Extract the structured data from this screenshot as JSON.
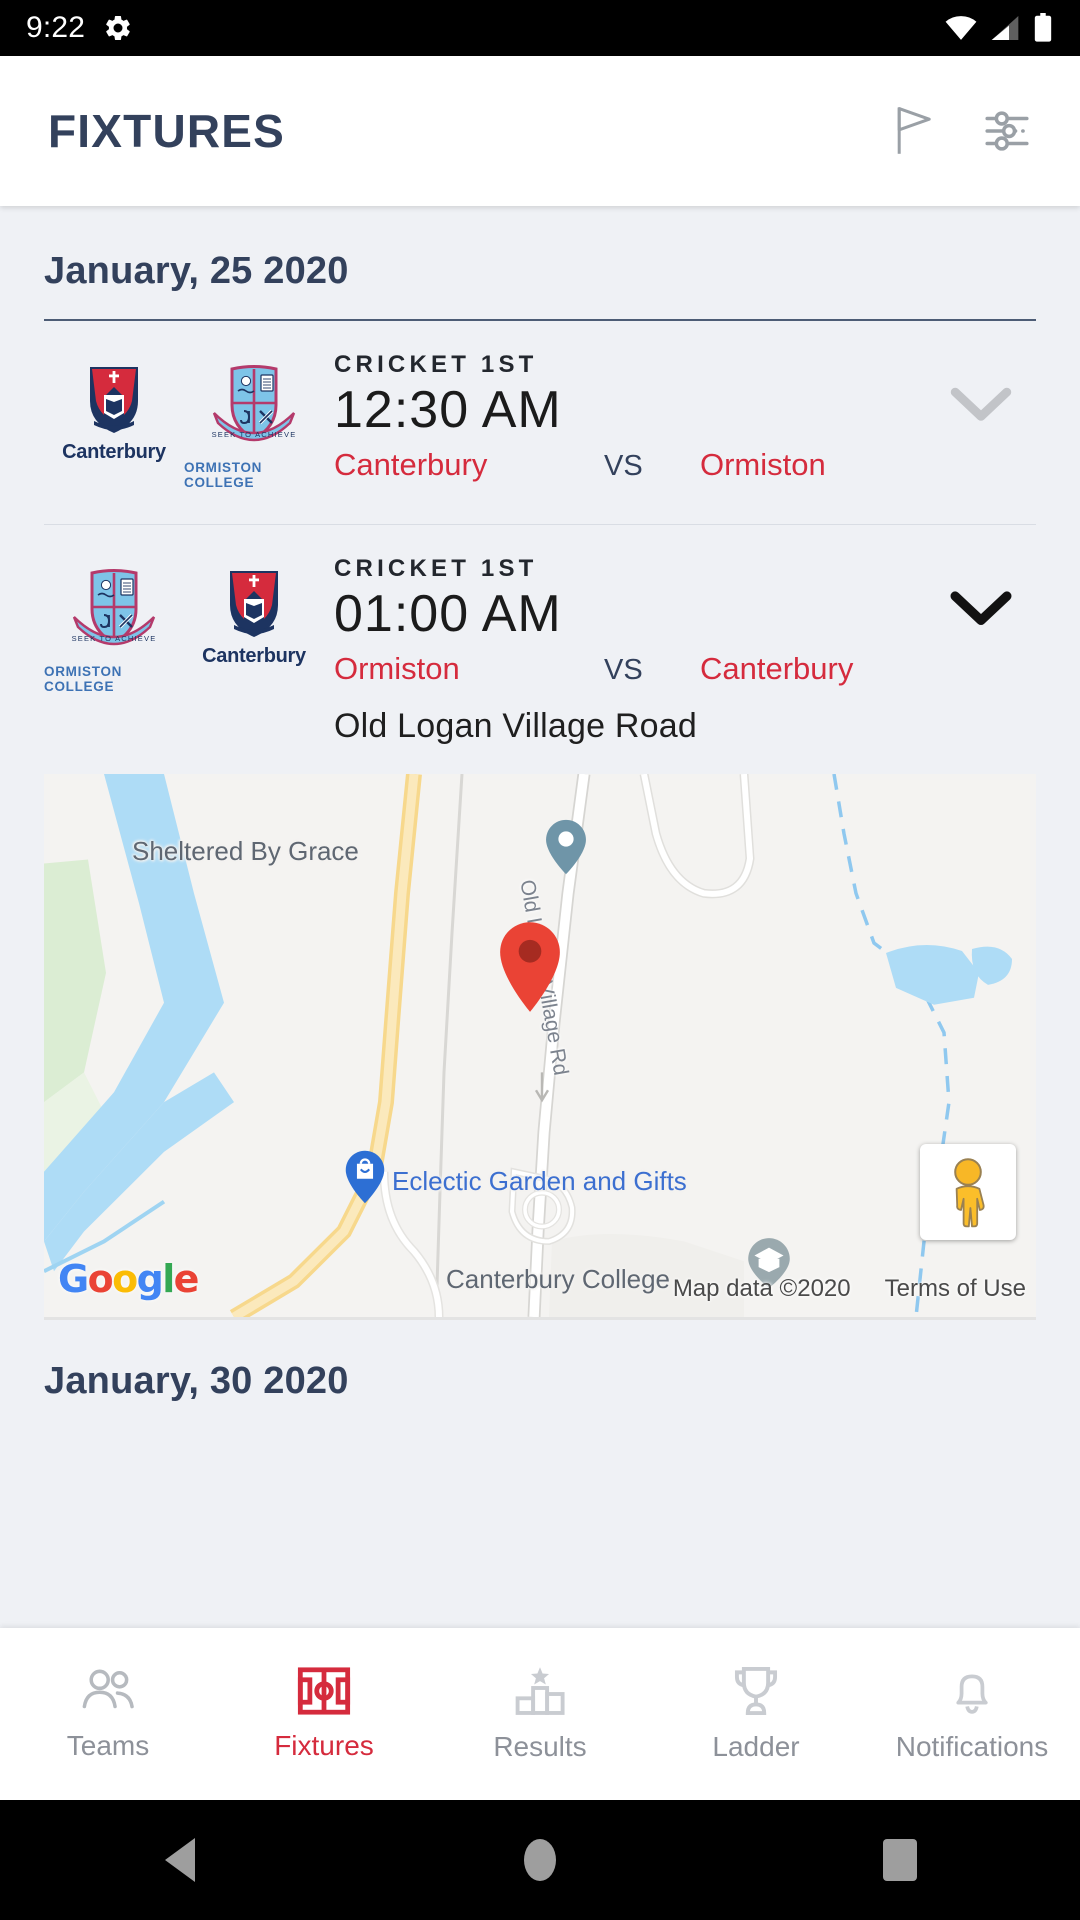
{
  "status_bar": {
    "time": "9:22",
    "left_icon": "gear-icon",
    "right_icons": [
      "wifi-icon",
      "cellular-signal-icon",
      "battery-icon"
    ]
  },
  "app_bar": {
    "title": "FIXTURES",
    "actions": [
      {
        "name": "flag-icon",
        "label": "Flag"
      },
      {
        "name": "filter-sliders-icon",
        "label": "Filter"
      }
    ]
  },
  "theme": {
    "accent_red": "#d52b3d",
    "navy": "#33415c",
    "page_bg": "#eff1f5",
    "surface": "#ffffff"
  },
  "sections": [
    {
      "date": "January, 25 2020",
      "fixtures": [
        {
          "sport": "CRICKET 1ST",
          "time": "12:30 AM",
          "home_team": "Canterbury",
          "vs": "VS",
          "away_team": "Ormiston",
          "home_crest": "canterbury-crest",
          "away_crest": "ormiston-college-crest",
          "home_crest_label": "Canterbury",
          "away_crest_label": "ORMISTON COLLEGE",
          "expanded": false,
          "chevron": "chevron-down-icon"
        },
        {
          "sport": "CRICKET 1ST",
          "time": "01:00 AM",
          "home_team": "Ormiston",
          "vs": "VS",
          "away_team": "Canterbury",
          "home_crest": "ormiston-college-crest",
          "away_crest": "canterbury-crest",
          "home_crest_label": "ORMISTON COLLEGE",
          "away_crest_label": "Canterbury",
          "expanded": true,
          "chevron": "chevron-down-icon",
          "venue": "Old Logan Village Road",
          "map": {
            "labels": [
              {
                "text": "Sheltered By Grace",
                "type": "poi-gray"
              },
              {
                "text": "Eclectic Garden and Gifts",
                "type": "poi-blue"
              },
              {
                "text": "Canterbury College",
                "type": "poi-gray"
              }
            ],
            "street_label": "Old Logan Village Rd",
            "provider": "Google",
            "attribution": "Map data ©2020",
            "terms": "Terms of Use",
            "marker": "location-marker",
            "street_view_control": "pegman-icon"
          }
        }
      ]
    },
    {
      "date": "January, 30 2020",
      "fixtures": []
    }
  ],
  "bottom_nav": {
    "items": [
      {
        "label": "Teams",
        "icon": "people-icon",
        "active": false
      },
      {
        "label": "Fixtures",
        "icon": "pitch-icon",
        "active": true
      },
      {
        "label": "Results",
        "icon": "podium-star-icon",
        "active": false
      },
      {
        "label": "Ladder",
        "icon": "trophy-icon",
        "active": false
      },
      {
        "label": "Notifications",
        "icon": "bell-icon",
        "active": false
      }
    ]
  },
  "android_nav": {
    "back": "back-triangle-icon",
    "home": "home-circle-icon",
    "recents": "recents-square-icon"
  }
}
